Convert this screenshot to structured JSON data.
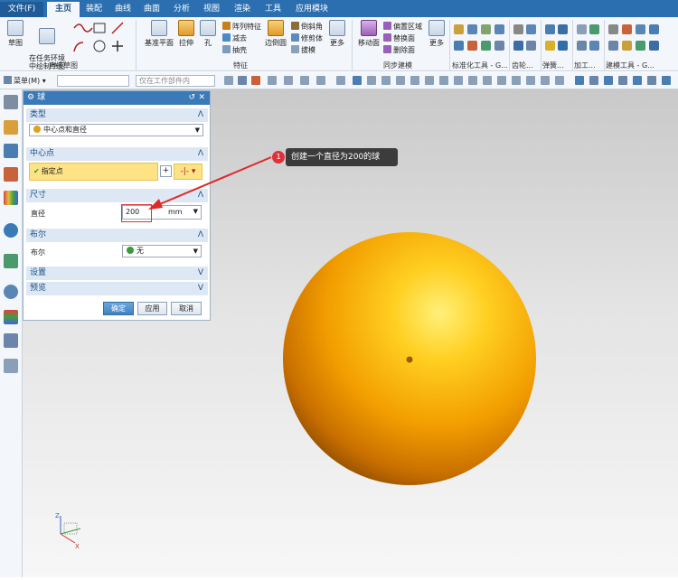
{
  "menu": {
    "file": "文件(F)",
    "tabs": [
      "主页",
      "装配",
      "曲线",
      "曲面",
      "分析",
      "视图",
      "渲染",
      "工具",
      "应用模块"
    ]
  },
  "ribbon": {
    "sketch": "草图",
    "sketch_in_task": "在任务环境\n中绘制草图",
    "direct_sketch_label": "直接草图",
    "datum_plane": "基准平面",
    "extrude": "拉伸",
    "hole": "孔",
    "pattern_feature": "阵列特征",
    "unite": "减去",
    "shell": "抽壳",
    "edge_blend": "边倒圆",
    "chamfer": "倒斜角",
    "trim_body": "修剪体",
    "draft": "拔模",
    "more": "更多",
    "feature_label": "特征",
    "move_face": "移动面",
    "offset_region": "偏置区域",
    "replace_face": "替换面",
    "delete_face": "删除面",
    "more2": "更多",
    "sync_label": "同步建模",
    "standard_tools": "标准化工具 - G...",
    "gear": "齿轮...",
    "spring": "弹簧...",
    "machining": "加工...",
    "modeling_tools": "建模工具 - G..."
  },
  "toolbar": {
    "menu_label": "菜单(M)",
    "filter_value": "",
    "scope_placeholder": "仅在工作部件内"
  },
  "dialog": {
    "title": "球",
    "type_section": "类型",
    "type_value": "中心点和直径",
    "center_section": "中心点",
    "specify_point": "指定点",
    "size_section": "尺寸",
    "diameter_label": "直径",
    "diameter_value": "200",
    "diameter_unit": "mm",
    "bool_section": "布尔",
    "bool_label": "布尔",
    "bool_value": "无",
    "settings_section": "设置",
    "preview_section": "预览",
    "ok": "确定",
    "apply": "应用",
    "cancel": "取消"
  },
  "callout": {
    "number": "1",
    "text": "创建一个直径为200的球"
  },
  "colors": {
    "menubar": "#2b6fb0",
    "accent": "#3a7ab8",
    "sphere": "#f2a000",
    "callout_badge": "#e0303a"
  }
}
